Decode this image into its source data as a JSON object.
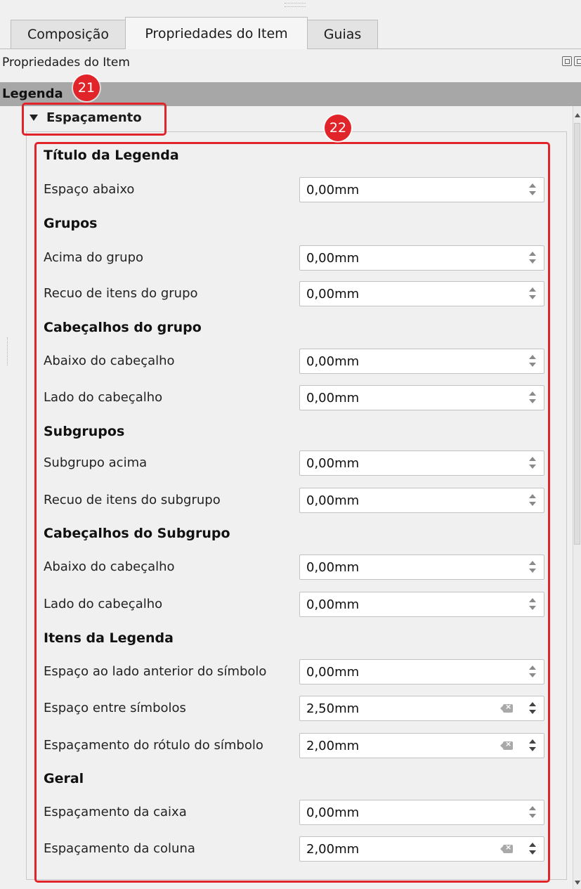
{
  "tabs": [
    {
      "label": "Composição",
      "active": false
    },
    {
      "label": "Propriedades do Item",
      "active": true
    },
    {
      "label": "Guias",
      "active": false
    }
  ],
  "panel_title": "Propriedades do Item",
  "section_header": "Legenda",
  "collapsible_group": {
    "label": "Espaçamento",
    "expanded": true
  },
  "rows": [
    {
      "kind": "subheader",
      "label": "Título da Legenda"
    },
    {
      "kind": "field",
      "label": "Espaço abaixo",
      "value": "0,00mm",
      "clear": false
    },
    {
      "kind": "subheader",
      "label": "Grupos"
    },
    {
      "kind": "field",
      "label": "Acima do grupo",
      "value": "0,00mm",
      "clear": false
    },
    {
      "kind": "field",
      "label": "Recuo de itens do grupo",
      "value": "0,00mm",
      "clear": false
    },
    {
      "kind": "subheader",
      "label": "Cabeçalhos do grupo"
    },
    {
      "kind": "field",
      "label": "Abaixo do cabeçalho",
      "value": "0,00mm",
      "clear": false
    },
    {
      "kind": "field",
      "label": "Lado do cabeçalho",
      "value": "0,00mm",
      "clear": false
    },
    {
      "kind": "subheader",
      "label": "Subgrupos"
    },
    {
      "kind": "field",
      "label": " Subgrupo acima",
      "value": "0,00mm",
      "clear": false
    },
    {
      "kind": "field",
      "label": "Recuo de itens do subgrupo",
      "value": "0,00mm",
      "clear": false
    },
    {
      "kind": "subheader",
      "label": "Cabeçalhos do Subgrupo"
    },
    {
      "kind": "field",
      "label": "Abaixo do cabeçalho",
      "value": "0,00mm",
      "clear": false
    },
    {
      "kind": "field",
      "label": "Lado do cabeçalho",
      "value": "0,00mm",
      "clear": false
    },
    {
      "kind": "subheader",
      "label": "Itens da Legenda"
    },
    {
      "kind": "field",
      "label": "Espaço ao lado anterior do símbolo",
      "value": "0,00mm",
      "clear": false
    },
    {
      "kind": "field",
      "label": "Espaço entre símbolos",
      "value": "2,50mm",
      "clear": true
    },
    {
      "kind": "field",
      "label": "Espaçamento do rótulo do símbolo",
      "value": "2,00mm",
      "clear": true
    },
    {
      "kind": "subheader",
      "label": "Geral"
    },
    {
      "kind": "field",
      "label": "Espaçamento da caixa",
      "value": "0,00mm",
      "clear": false
    },
    {
      "kind": "field",
      "label": "Espaçamento da coluna",
      "value": "2,00mm",
      "clear": true
    }
  ],
  "annotations": [
    {
      "number": "21",
      "color": "#e0242a"
    },
    {
      "number": "22",
      "color": "#e0242a"
    }
  ],
  "icons": {
    "collapse": "triangle-down-icon",
    "spin": "spinbox-arrows-icon",
    "clear": "clear-field-icon",
    "dock_float": "float-window-icon",
    "dock_close": "close-window-icon"
  }
}
